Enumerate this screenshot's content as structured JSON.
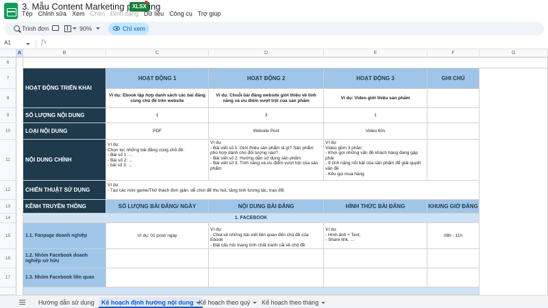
{
  "app": {
    "title": "3. Mẫu Content Marketing planning",
    "file_badge": "XLSX"
  },
  "menu": [
    "Tệp",
    "Chỉnh sửa",
    "Xem",
    "Chèn",
    "Định dạng",
    "Dữ liệu",
    "Công cụ",
    "Trợ giúp"
  ],
  "toolbar": {
    "search_label": "Trình đơn",
    "zoom": "90%",
    "view_only": "Chỉ xem"
  },
  "formula_bar": {
    "cell_ref": "A1",
    "fx": "fx"
  },
  "columns": [
    "A",
    "B",
    "C",
    "D",
    "E",
    "F",
    "G"
  ],
  "rows": [
    "6",
    "7",
    "8",
    "9",
    "10",
    "11",
    "12",
    "13",
    "14",
    "15",
    "16",
    "17"
  ],
  "sheet": {
    "hoat_dong_trien_khai": "HOẠT ĐỘNG TRIỂN KHAI",
    "hd1": "HOẠT ĐỘNG 1",
    "hd2": "HOẠT ĐỘNG 2",
    "hd3": "HOẠT ĐỘNG 3",
    "ghi_chu": "GHI CHÚ",
    "hd1_vd": "Ví dụ: Ebook tập hợp danh sách các bài đăng cùng chủ đề trên website",
    "hd2_vd": "Ví dụ: Chuỗi bài đăng website giới thiệu về tính năng và ưu điểm vượt trội của sản phẩm",
    "hd3_vd": "Ví dụ: Video giới thiệu sản phẩm",
    "so_luong": "SỐ LƯỢNG NỘI DUNG",
    "sl1": "1",
    "sl2": "3",
    "sl3": "1",
    "loai": "LOẠI NỘI DUNG",
    "loai1": "PDF",
    "loai2": "Website Post",
    "loai3": "Video 60s",
    "noi_dung_chinh": "NỘI DUNG CHÍNH",
    "ndc1": "Ví dụ:\nChọn lọc những bài đăng cùng chủ đề:\n- Bài số 1: ...\n- Bài số 2: ...\n- bài số 3: ...",
    "ndc2": "Ví dụ:\n- Bài viết số 1: Giới thiệu sản phẩm là gì? Sản phẩm phù hợp dành cho đối tượng nào?\n- Bài viết số 2. Hướng dẫn sử dụng sản phẩm\n- Bài viết số 3. Tính năng và ưu điểm vượt trội của sản phẩm",
    "ndc3": "Ví dụ:\nVideo gồm 3 phần:\n- Khơi gợi những vấn đề khách hàng đang gặp phải\n- 9 tính năng nổi bật của sản phẩm để giải quyết vấn đề\n- Kêu gọi mua hàng",
    "chien_thuat": "CHIẾN THUẬT SỬ DỤNG",
    "ct_text": "Ví dụ:\n- Tạo các mini game/Thử thách đơn giản, dễ chơi để thu hút, tăng tính tương tác, trao đổi",
    "kenh": "KÊNH TRUYỀN THÔNG",
    "h_so_luong_bai": "SỐ LƯỢNG BÀI ĐĂNG/ NGÀY",
    "h_noi_dung_bai": "NỘI DUNG BÀI ĐĂNG",
    "h_hinh_thuc": "HÌNH THỨC BÀI ĐĂNG",
    "h_khung_gio": "KHUNG GIỜ ĐĂNG",
    "facebook": "1. FACEBOOK",
    "fanpage": "1.1. Fanpage doanh nghiệp",
    "fanpage_sl": "Ví dụ: 01 post/ ngày",
    "fanpage_nd": "Ví dụ:\n- Chia sẻ những bài viết liên quan đến chủ đề của Ebook\n- Đặt câu hỏi mang tính chất tranh cãi về chủ đề",
    "fanpage_ht": "Ví dụ:\n- Hình ảnh + Text;\n- Share link, ...",
    "fanpage_kg": "08h - 11h",
    "nhom_sohuu": "1.2. Nhóm Facebook doanh nghiệp sở hữu",
    "nhom_lienquan": "1.3. Nhóm Facebook liên quan"
  },
  "sheet_tabs": [
    "Hướng dẫn sử dụng",
    "Kế hoạch định hướng nội dung",
    "Kế hoạch theo quý",
    "Kế hoạch theo tháng"
  ],
  "colors": {
    "dark_header": "#1f3a4d",
    "blue_header": "#9fc5e8",
    "light_blue": "#cfe2f3",
    "brand_green": "#0f9d58"
  }
}
